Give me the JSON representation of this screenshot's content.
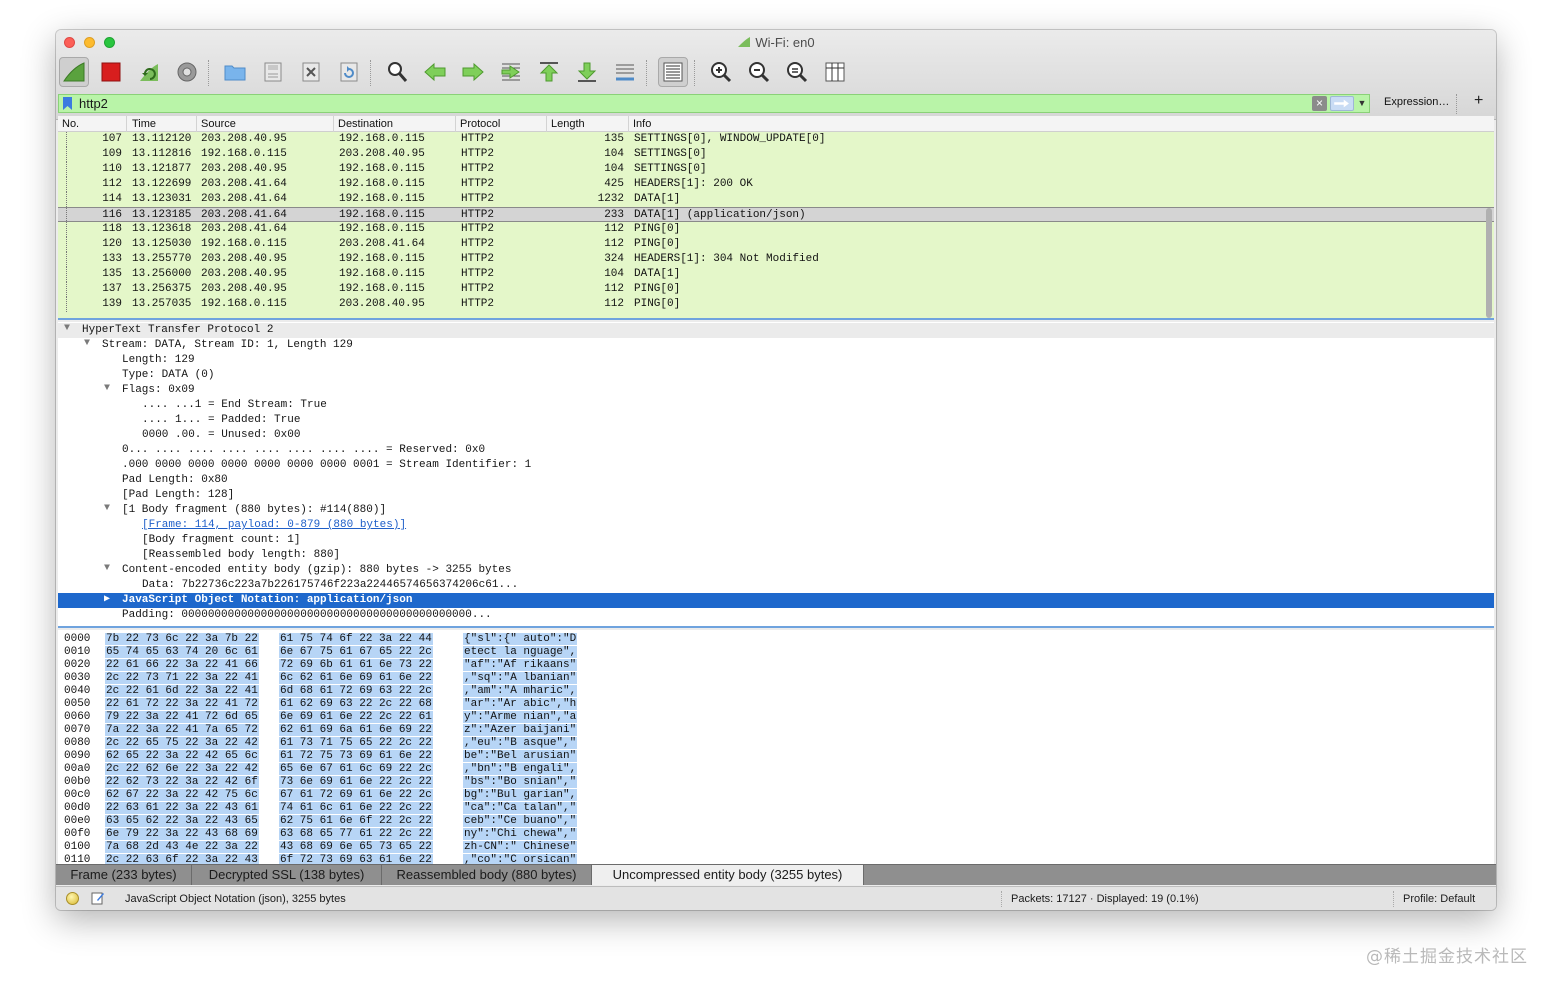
{
  "window": {
    "title": "Wi-Fi: en0"
  },
  "toolbar": {
    "buttons": [
      {
        "name": "start-capture-icon"
      },
      {
        "name": "stop-capture-icon"
      },
      {
        "name": "restart-capture-icon"
      },
      {
        "name": "capture-options-icon"
      },
      {
        "name": "open-file-icon"
      },
      {
        "name": "save-file-icon"
      },
      {
        "name": "close-file-icon"
      },
      {
        "name": "reload-file-icon"
      },
      {
        "name": "find-packet-icon"
      },
      {
        "name": "go-back-icon"
      },
      {
        "name": "go-forward-icon"
      },
      {
        "name": "go-to-packet-icon"
      },
      {
        "name": "go-first-packet-icon"
      },
      {
        "name": "go-last-packet-icon"
      },
      {
        "name": "auto-scroll-icon"
      },
      {
        "name": "colorize-icon"
      },
      {
        "name": "zoom-in-icon"
      },
      {
        "name": "zoom-out-icon"
      },
      {
        "name": "zoom-normal-icon"
      },
      {
        "name": "resize-columns-icon"
      }
    ]
  },
  "filter": {
    "value": "http2",
    "expression_label": "Expression…",
    "add_label": "+"
  },
  "packet_list": {
    "columns": [
      "No.",
      "Time",
      "Source",
      "Destination",
      "Protocol",
      "Length",
      "Info"
    ],
    "rows": [
      {
        "no": "107",
        "time": "13.112120",
        "src": "203.208.40.95",
        "dst": "192.168.0.115",
        "proto": "HTTP2",
        "len": "135",
        "info": "SETTINGS[0], WINDOW_UPDATE[0]"
      },
      {
        "no": "109",
        "time": "13.112816",
        "src": "192.168.0.115",
        "dst": "203.208.40.95",
        "proto": "HTTP2",
        "len": "104",
        "info": "SETTINGS[0]"
      },
      {
        "no": "110",
        "time": "13.121877",
        "src": "203.208.40.95",
        "dst": "192.168.0.115",
        "proto": "HTTP2",
        "len": "104",
        "info": "SETTINGS[0]"
      },
      {
        "no": "112",
        "time": "13.122699",
        "src": "203.208.41.64",
        "dst": "192.168.0.115",
        "proto": "HTTP2",
        "len": "425",
        "info": "HEADERS[1]: 200 OK"
      },
      {
        "no": "114",
        "time": "13.123031",
        "src": "203.208.41.64",
        "dst": "192.168.0.115",
        "proto": "HTTP2",
        "len": "1232",
        "info": "DATA[1]"
      },
      {
        "no": "116",
        "time": "13.123185",
        "src": "203.208.41.64",
        "dst": "192.168.0.115",
        "proto": "HTTP2",
        "len": "233",
        "info": "DATA[1] (application/json)"
      },
      {
        "no": "118",
        "time": "13.123618",
        "src": "203.208.41.64",
        "dst": "192.168.0.115",
        "proto": "HTTP2",
        "len": "112",
        "info": "PING[0]"
      },
      {
        "no": "120",
        "time": "13.125030",
        "src": "192.168.0.115",
        "dst": "203.208.41.64",
        "proto": "HTTP2",
        "len": "112",
        "info": "PING[0]"
      },
      {
        "no": "133",
        "time": "13.255770",
        "src": "203.208.40.95",
        "dst": "192.168.0.115",
        "proto": "HTTP2",
        "len": "324",
        "info": "HEADERS[1]: 304 Not Modified"
      },
      {
        "no": "135",
        "time": "13.256000",
        "src": "203.208.40.95",
        "dst": "192.168.0.115",
        "proto": "HTTP2",
        "len": "104",
        "info": "DATA[1]"
      },
      {
        "no": "137",
        "time": "13.256375",
        "src": "203.208.40.95",
        "dst": "192.168.0.115",
        "proto": "HTTP2",
        "len": "112",
        "info": "PING[0]"
      },
      {
        "no": "139",
        "time": "13.257035",
        "src": "192.168.0.115",
        "dst": "203.208.40.95",
        "proto": "HTTP2",
        "len": "112",
        "info": "PING[0]"
      }
    ],
    "selected_no": "116"
  },
  "details": {
    "lines": [
      {
        "text": "HyperText Transfer Protocol 2",
        "level": 0,
        "tri": "open"
      },
      {
        "text": "Stream: DATA, Stream ID: 1, Length 129",
        "level": 1,
        "tri": "open"
      },
      {
        "text": "Length: 129",
        "level": 2,
        "tri": ""
      },
      {
        "text": "Type: DATA (0)",
        "level": 2,
        "tri": ""
      },
      {
        "text": "Flags: 0x09",
        "level": 2,
        "tri": "open"
      },
      {
        "text": ".... ...1 = End Stream: True",
        "level": 3,
        "tri": ""
      },
      {
        "text": ".... 1... = Padded: True",
        "level": 3,
        "tri": ""
      },
      {
        "text": "0000 .00. = Unused: 0x00",
        "level": 3,
        "tri": ""
      },
      {
        "text": "0... .... .... .... .... .... .... .... = Reserved: 0x0",
        "level": 2,
        "tri": ""
      },
      {
        "text": ".000 0000 0000 0000 0000 0000 0000 0001 = Stream Identifier: 1",
        "level": 2,
        "tri": ""
      },
      {
        "text": "Pad Length: 0x80",
        "level": 2,
        "tri": ""
      },
      {
        "text": "[Pad Length: 128]",
        "level": 2,
        "tri": ""
      },
      {
        "text": "[1 Body fragment (880 bytes): #114(880)]",
        "level": 2,
        "tri": "open"
      },
      {
        "text": "[Frame: 114, payload: 0-879 (880 bytes)]",
        "level": 3,
        "tri": "",
        "link": true
      },
      {
        "text": "[Body fragment count: 1]",
        "level": 3,
        "tri": ""
      },
      {
        "text": "[Reassembled body length: 880]",
        "level": 3,
        "tri": ""
      },
      {
        "text": "Content-encoded entity body (gzip): 880 bytes -> 3255 bytes",
        "level": 2,
        "tri": "open"
      },
      {
        "text": "Data: 7b22736c223a7b226175746f223a22446574656374206c61...",
        "level": 3,
        "tri": ""
      },
      {
        "text": "JavaScript Object Notation: application/json",
        "level": 2,
        "tri": "closed",
        "selected": true
      },
      {
        "text": "Padding: 00000000000000000000000000000000000000000000...",
        "level": 2,
        "tri": ""
      }
    ]
  },
  "bytes": {
    "rows": [
      {
        "off": "0000",
        "hex1": "7b 22 73 6c 22 3a 7b 22",
        "hex2": "61 75 74 6f 22 3a 22 44",
        "ascii": "{\"sl\":{\" auto\":\"D"
      },
      {
        "off": "0010",
        "hex1": "65 74 65 63 74 20 6c 61",
        "hex2": "6e 67 75 61 67 65 22 2c",
        "ascii": "etect la nguage\","
      },
      {
        "off": "0020",
        "hex1": "22 61 66 22 3a 22 41 66",
        "hex2": "72 69 6b 61 61 6e 73 22",
        "ascii": "\"af\":\"Af rikaans\""
      },
      {
        "off": "0030",
        "hex1": "2c 22 73 71 22 3a 22 41",
        "hex2": "6c 62 61 6e 69 61 6e 22",
        "ascii": ",\"sq\":\"A lbanian\""
      },
      {
        "off": "0040",
        "hex1": "2c 22 61 6d 22 3a 22 41",
        "hex2": "6d 68 61 72 69 63 22 2c",
        "ascii": ",\"am\":\"A mharic\","
      },
      {
        "off": "0050",
        "hex1": "22 61 72 22 3a 22 41 72",
        "hex2": "61 62 69 63 22 2c 22 68",
        "ascii": "\"ar\":\"Ar abic\",\"h"
      },
      {
        "off": "0060",
        "hex1": "79 22 3a 22 41 72 6d 65",
        "hex2": "6e 69 61 6e 22 2c 22 61",
        "ascii": "y\":\"Arme nian\",\"a"
      },
      {
        "off": "0070",
        "hex1": "7a 22 3a 22 41 7a 65 72",
        "hex2": "62 61 69 6a 61 6e 69 22",
        "ascii": "z\":\"Azer baijani\""
      },
      {
        "off": "0080",
        "hex1": "2c 22 65 75 22 3a 22 42",
        "hex2": "61 73 71 75 65 22 2c 22",
        "ascii": ",\"eu\":\"B asque\",\""
      },
      {
        "off": "0090",
        "hex1": "62 65 22 3a 22 42 65 6c",
        "hex2": "61 72 75 73 69 61 6e 22",
        "ascii": "be\":\"Bel arusian\""
      },
      {
        "off": "00a0",
        "hex1": "2c 22 62 6e 22 3a 22 42",
        "hex2": "65 6e 67 61 6c 69 22 2c",
        "ascii": ",\"bn\":\"B engali\","
      },
      {
        "off": "00b0",
        "hex1": "22 62 73 22 3a 22 42 6f",
        "hex2": "73 6e 69 61 6e 22 2c 22",
        "ascii": "\"bs\":\"Bo snian\",\""
      },
      {
        "off": "00c0",
        "hex1": "62 67 22 3a 22 42 75 6c",
        "hex2": "67 61 72 69 61 6e 22 2c",
        "ascii": "bg\":\"Bul garian\","
      },
      {
        "off": "00d0",
        "hex1": "22 63 61 22 3a 22 43 61",
        "hex2": "74 61 6c 61 6e 22 2c 22",
        "ascii": "\"ca\":\"Ca talan\",\""
      },
      {
        "off": "00e0",
        "hex1": "63 65 62 22 3a 22 43 65",
        "hex2": "62 75 61 6e 6f 22 2c 22",
        "ascii": "ceb\":\"Ce buano\",\""
      },
      {
        "off": "00f0",
        "hex1": "6e 79 22 3a 22 43 68 69",
        "hex2": "63 68 65 77 61 22 2c 22",
        "ascii": "ny\":\"Chi chewa\",\""
      },
      {
        "off": "0100",
        "hex1": "7a 68 2d 43 4e 22 3a 22",
        "hex2": "43 68 69 6e 65 73 65 22",
        "ascii": "zh-CN\":\" Chinese\""
      },
      {
        "off": "0110",
        "hex1": "2c 22 63 6f 22 3a 22 43",
        "hex2": "6f 72 73 69 63 61 6e 22",
        "ascii": ",\"co\":\"C orsican\""
      }
    ]
  },
  "byte_tabs": [
    "Frame (233 bytes)",
    "Decrypted SSL (138 bytes)",
    "Reassembled body (880 bytes)",
    "Uncompressed entity body (3255 bytes)"
  ],
  "active_tab": 3,
  "status": {
    "text": "JavaScript Object Notation (json), 3255 bytes",
    "packets": "Packets: 17127 · Displayed: 19 (0.1%)",
    "profile": "Profile: Default"
  },
  "watermark": "@稀土掘金技术社区",
  "colors": {
    "filter_ok": "#b9f4a8",
    "row_bg": "#e4f7c9",
    "selected_detail": "#1e68cc",
    "byte_highlight": "#b7d5f6"
  }
}
